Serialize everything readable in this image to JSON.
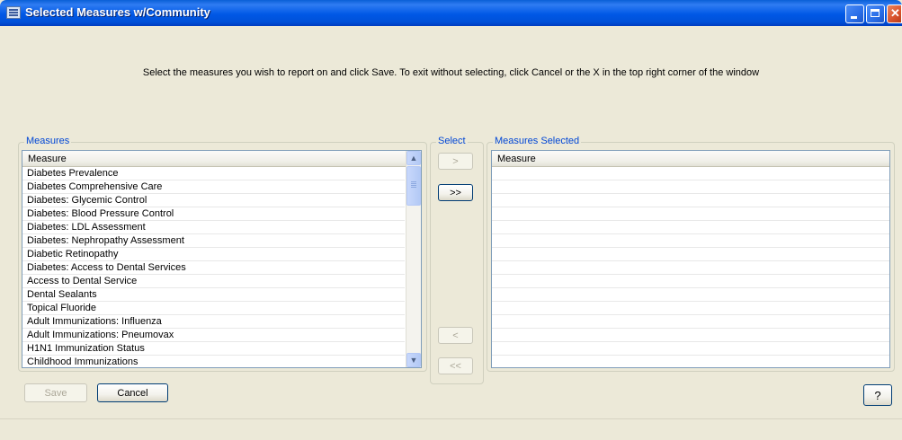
{
  "window": {
    "title": "Selected Measures w/Community"
  },
  "instruction": "Select the measures you wish to report on and click Save.  To exit without selecting, click Cancel or the X in the top right corner of the window",
  "measures_group": {
    "label": "Measures",
    "column_header": "Measure",
    "items": [
      "Diabetes Prevalence",
      "Diabetes Comprehensive Care",
      "Diabetes: Glycemic Control",
      "Diabetes: Blood Pressure Control",
      "Diabetes: LDL Assessment",
      "Diabetes: Nephropathy Assessment",
      "Diabetic Retinopathy",
      "Diabetes: Access to Dental Services",
      "Access to Dental Service",
      "Dental Sealants",
      "Topical Fluoride",
      "Adult Immunizations: Influenza",
      "Adult Immunizations: Pneumovax",
      "H1N1 Immunization Status",
      "Childhood Immunizations"
    ]
  },
  "select_group": {
    "label": "Select",
    "move_right": ">",
    "move_all_right": ">>",
    "move_left": "<",
    "move_all_left": "<<"
  },
  "selected_group": {
    "label": "Measures Selected",
    "column_header": "Measure",
    "items": []
  },
  "buttons": {
    "save": "Save",
    "cancel": "Cancel",
    "help": "?"
  },
  "colors": {
    "titlebar": "#0058e6",
    "group_label": "#0046d5",
    "window_bg": "#ece9d8"
  }
}
